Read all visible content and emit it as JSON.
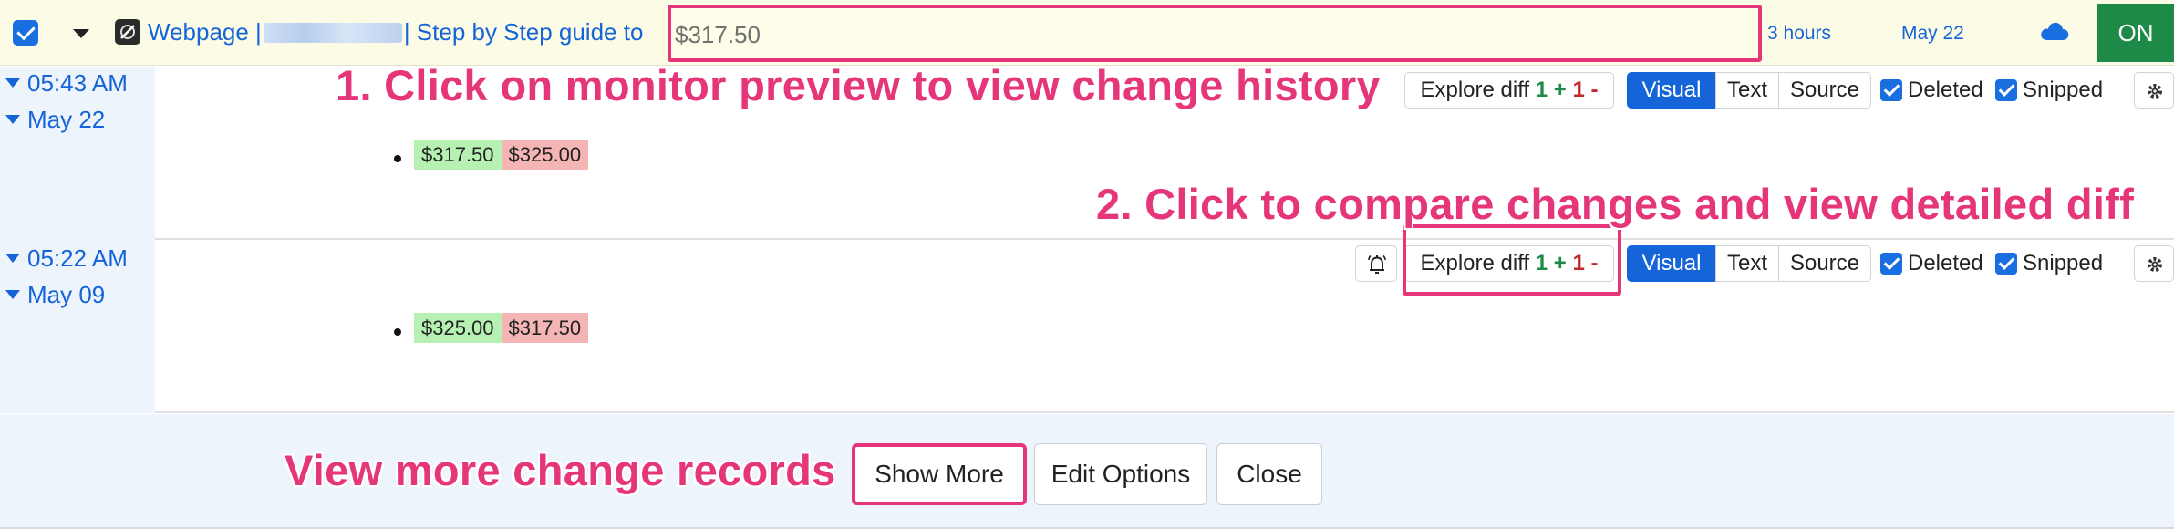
{
  "monitor": {
    "title_prefix": "Webpage |",
    "title_suffix": "| Step by Step guide to",
    "preview_value": "$317.50",
    "last_check": "3 hours",
    "last_change_date": "May 22",
    "status": "ON"
  },
  "annotations": {
    "step1": "1. Click on monitor preview to view change history",
    "step2": "2. Click to compare changes and view detailed diff",
    "more": "View more change records"
  },
  "history": [
    {
      "time": "05:43 AM",
      "date": "May 22",
      "inserted": "$317.50",
      "deleted": "$325.00",
      "explore_label": "Explore diff",
      "added_count": "1",
      "removed_count": "1"
    },
    {
      "time": "05:22 AM",
      "date": "May 09",
      "inserted": "$325.00",
      "deleted": "$317.50",
      "explore_label": "Explore diff",
      "added_count": "1",
      "removed_count": "1"
    }
  ],
  "view_modes": {
    "visual": "Visual",
    "text": "Text",
    "source": "Source"
  },
  "filters": {
    "deleted": "Deleted",
    "snipped": "Snipped"
  },
  "symbols": {
    "plus": "+",
    "minus": "-"
  },
  "footer": {
    "show_more": "Show More",
    "edit_options": "Edit Options",
    "close": "Close"
  },
  "colors": {
    "accent": "#e5367a",
    "link": "#1565d8",
    "on": "#1d8a48",
    "inserted": "#b7f0b3",
    "deleted": "#f6b5b5"
  },
  "icons": [
    "checkbox-icon",
    "caret-down-icon",
    "favicon-icon",
    "cloud-icon",
    "bell-icon",
    "gear-icon"
  ]
}
